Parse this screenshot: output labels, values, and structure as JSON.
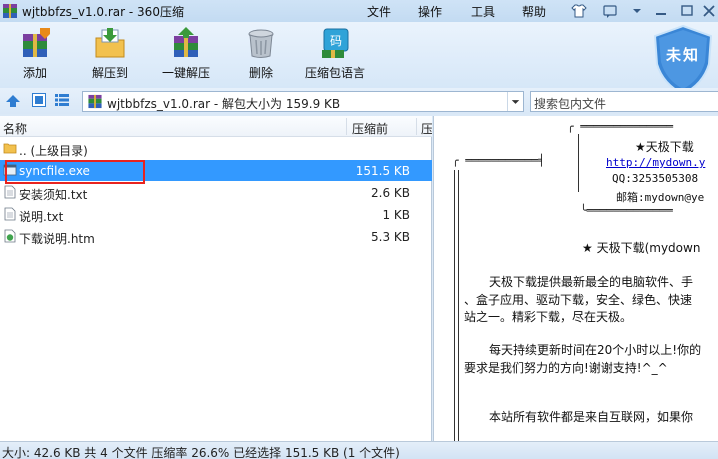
{
  "window": {
    "title": "wjtbbfzs_v1.0.rar - 360压缩",
    "menu": [
      "文件",
      "操作",
      "工具",
      "帮助"
    ]
  },
  "toolbar": {
    "buttons": [
      {
        "label": "添加",
        "icon": "add-archive-icon"
      },
      {
        "label": "解压到",
        "icon": "extract-to-icon"
      },
      {
        "label": "一键解压",
        "icon": "one-click-extract-icon"
      },
      {
        "label": "删除",
        "icon": "delete-icon"
      },
      {
        "label": "压缩包语言",
        "icon": "archive-language-icon"
      }
    ],
    "badge": {
      "label": "未知",
      "color": "#3a86d6"
    }
  },
  "address": {
    "path": "wjtbbfzs_v1.0.rar - 解包大小为 159.9 KB",
    "search_placeholder": "搜索包内文件"
  },
  "columns": {
    "name": "名称",
    "packed_size": "压缩前",
    "ratio": "压缩后"
  },
  "files": [
    {
      "name": ".. (上级目录)",
      "size": "",
      "icon": "parent-folder-icon"
    },
    {
      "name": "syncfile.exe",
      "size": "151.5 KB",
      "icon": "exe-file-icon",
      "selected": true
    },
    {
      "name": "安装须知.txt",
      "size": "2.6 KB",
      "icon": "text-file-icon"
    },
    {
      "name": "说明.txt",
      "size": "1 KB",
      "icon": "text-file-icon"
    },
    {
      "name": "下载说明.htm",
      "size": "5.3 KB",
      "icon": "html-file-icon"
    }
  ],
  "preview": {
    "box_title": "★天极下载",
    "box_url": "http://mydown.y",
    "box_qq": "QQ:3253505308",
    "box_email": "邮箱:mydown@ye",
    "heading": "★  天极下载(mydown",
    "p1_l1": "天极下载提供最新最全的电脑软件、手",
    "p1_l2": "、盒子应用、驱动下载，安全、绿色、快速",
    "p1_l3": "站之一。精彩下载，尽在天极。",
    "p2_l1": "每天持续更新时间在20个小时以上!你的",
    "p2_l2": "要求是我们努力的方向!谢谢支持!^_^",
    "p3_l1": "本站所有软件都是来自互联网，如果你"
  },
  "status": {
    "text": "大小: 42.6 KB 共 4 个文件 压缩率 26.6% 已经选择 151.5 KB (1 个文件)"
  },
  "colors": {
    "selection": "#3399ff",
    "highlight_box": "#e8231f",
    "titlebar": "#c9def4"
  }
}
